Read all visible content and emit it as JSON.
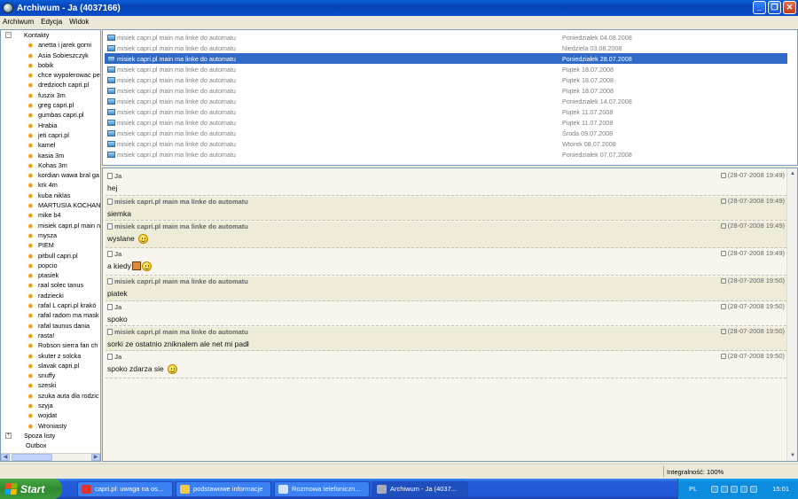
{
  "window": {
    "title": "Archiwum - Ja (4037166)"
  },
  "menu": [
    "Archiwum",
    "Edycja",
    "Widok"
  ],
  "tree": {
    "kontakty_label": "Kontakty",
    "contacts": [
      "anetta i jarek gorni",
      "Asia  Sobieszczyk",
      "bobik",
      "chce wypolerowac pe",
      "dredzioch capri.pl",
      "fuszix 3m",
      "greg capri.pl",
      "gumbas capri.pl",
      "Hrabia",
      "jeti capri.pl",
      "kamel",
      "kasia 3m",
      "Kohas 3m",
      "kordian wawa bral ga",
      "krk 4m",
      "kuba niklas",
      "MARTUSIA KOCHAN",
      "mike b4",
      "misiek capri.pl main n",
      "mysza",
      "PIEM",
      "pitbull capri.pl",
      "popcio",
      "ptasiek",
      "raal solec tanus",
      "radziecki",
      "rafal L capri.pl krakó",
      "rafal radom ma mask",
      "rafal taunus dania",
      "rasta!",
      "Robson sierra fan ch",
      "skuter z solcka",
      "slavak capri.pl",
      "snuffy",
      "szeski",
      "szuka auta dla rodzic",
      "szyja",
      "wojdat",
      "Wroniasty"
    ],
    "spoza_label": "Spoza listy",
    "outbox_label": "Outbox"
  },
  "messages": [
    {
      "subject": "misiek capri.pl main ma linke do automatu",
      "date": "Poniedziałek 04.08.2008"
    },
    {
      "subject": "misiek capri.pl main ma linke do automatu",
      "date": "Niedziela 03.08.2008"
    },
    {
      "subject": "misiek capri.pl main ma linke do automatu",
      "date": "Poniedziałek 28.07.2008"
    },
    {
      "subject": "misiek capri.pl main ma linke do automatu",
      "date": "Piątek 18.07.2008"
    },
    {
      "subject": "misiek capri.pl main ma linke do automatu",
      "date": "Piątek 18.07.2008"
    },
    {
      "subject": "misiek capri.pl main ma linke do automatu",
      "date": "Piątek 18.07.2008"
    },
    {
      "subject": "misiek capri.pl main ma linke do automatu",
      "date": "Poniedziałek 14.07.2008"
    },
    {
      "subject": "misiek capri.pl main ma linke do automatu",
      "date": "Piątek 11.07.2008"
    },
    {
      "subject": "misiek capri.pl main ma linke do automatu",
      "date": "Piątek 11.07.2008"
    },
    {
      "subject": "misiek capri.pl main ma linke do automatu",
      "date": "Środa 09.07.2008"
    },
    {
      "subject": "misiek capri.pl main ma linke do automatu",
      "date": "Wtorek 08.07.2008"
    },
    {
      "subject": "misiek capri.pl main ma linke do automatu",
      "date": "Poniedziałek 07.07.2008"
    }
  ],
  "selected_message_index": 2,
  "conversation": [
    {
      "sender": "Ja",
      "time": "(28-07-2008 19:49)",
      "text": "hej"
    },
    {
      "sender": "misiek capri.pl main ma linke do automatu",
      "time": "(28-07-2008 19:49)",
      "text": "siemka"
    },
    {
      "sender": "misiek capri.pl main ma linke do automatu",
      "time": "(28-07-2008 19:49)",
      "text": "wyslane"
    },
    {
      "sender": "Ja",
      "time": "(28-07-2008 19:49)",
      "text": "a kiedy"
    },
    {
      "sender": "misiek capri.pl main ma linke do automatu",
      "time": "(28-07-2008 19:50)",
      "text": "piatek"
    },
    {
      "sender": "Ja",
      "time": "(28-07-2008 19:50)",
      "text": "spoko"
    },
    {
      "sender": "misiek capri.pl main ma linke do automatu",
      "time": "(28-07-2008 19:50)",
      "text": "sorki ze ostatnio zniknalem ale net mi padł"
    },
    {
      "sender": "Ja",
      "time": "(28-07-2008 19:50)",
      "text": "spoko zdarza sie"
    }
  ],
  "status": {
    "integrity": "Integralność: 100%"
  },
  "taskbar": {
    "start": "Start",
    "tasks": [
      "capri.pl: uwaga na os...",
      "podstawowe informacje",
      "Rozmowa telefoniczn...",
      "Archiwum - Ja (4037..."
    ],
    "lang": "PL",
    "clock": "15:01"
  }
}
